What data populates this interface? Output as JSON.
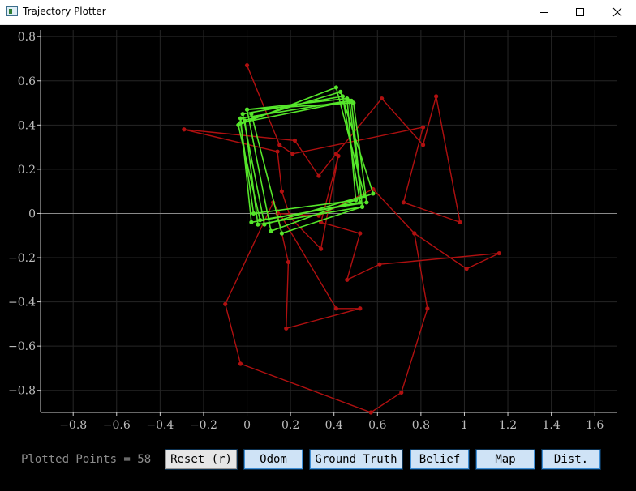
{
  "window": {
    "title": "Trajectory Plotter",
    "minimize_icon": "minimize-icon",
    "maximize_icon": "maximize-icon",
    "close_icon": "close-icon"
  },
  "status": {
    "plotted_points_label": "Plotted Points = 58"
  },
  "buttons": [
    {
      "name": "reset-button",
      "label": "Reset (r)"
    },
    {
      "name": "odom-button",
      "label": "Odom"
    },
    {
      "name": "ground-truth-button",
      "label": "Ground Truth"
    },
    {
      "name": "belief-button",
      "label": "Belief"
    },
    {
      "name": "map-button",
      "label": "Map"
    },
    {
      "name": "dist-button",
      "label": "Dist."
    }
  ],
  "colors": {
    "background": "#000000",
    "grid": "#262626",
    "axis_zero": "#8a8a8a",
    "tick_label": "#bdbdbd",
    "red_series": "#b01010",
    "green_series": "#55e62a"
  },
  "chart_data": {
    "type": "line",
    "title": "",
    "xlabel": "",
    "ylabel": "",
    "xlim": [
      -0.95,
      1.7
    ],
    "ylim": [
      -0.9,
      0.83
    ],
    "xticks": [
      -0.8,
      -0.6,
      -0.4,
      -0.2,
      0,
      0.2,
      0.4,
      0.6,
      0.8,
      1,
      1.2,
      1.4,
      1.6
    ],
    "xtick_labels": [
      "−0.8",
      "−0.6",
      "−0.4",
      "−0.2",
      "0",
      "0.2",
      "0.4",
      "0.6",
      "0.8",
      "1",
      "1.2",
      "1.4",
      "1.6"
    ],
    "yticks": [
      0.8,
      0.6,
      0.4,
      0.2,
      0,
      -0.2,
      -0.4,
      -0.6,
      -0.8
    ],
    "ytick_labels": [
      "0.8",
      "0.6",
      "0.4",
      "0.2",
      "0",
      "−0.2",
      "−0.4",
      "−0.6",
      "−0.8"
    ],
    "grid": true,
    "series": [
      {
        "color": "#b01010",
        "points": [
          [
            0.0,
            0.67
          ],
          [
            0.15,
            0.31
          ],
          [
            0.21,
            0.27
          ],
          [
            0.81,
            0.39
          ],
          [
            0.72,
            0.05
          ],
          [
            0.98,
            -0.04
          ],
          [
            0.87,
            0.53
          ],
          [
            0.81,
            0.31
          ],
          [
            0.62,
            0.52
          ],
          [
            0.41,
            0.27
          ],
          [
            0.33,
            0.17
          ],
          [
            0.22,
            0.33
          ],
          [
            -0.29,
            0.38
          ],
          [
            0.14,
            0.28
          ],
          [
            0.16,
            0.1
          ],
          [
            0.2,
            -0.02
          ],
          [
            0.34,
            -0.16
          ],
          [
            0.42,
            0.26
          ],
          [
            0.34,
            -0.04
          ],
          [
            0.52,
            -0.09
          ],
          [
            0.46,
            -0.3
          ],
          [
            0.61,
            -0.23
          ],
          [
            1.16,
            -0.18
          ],
          [
            1.01,
            -0.25
          ],
          [
            0.77,
            -0.09
          ],
          [
            0.58,
            0.11
          ],
          [
            0.33,
            -0.01
          ],
          [
            0.14,
            0.0
          ],
          [
            0.19,
            -0.22
          ],
          [
            0.18,
            -0.52
          ],
          [
            0.52,
            -0.43
          ],
          [
            0.41,
            -0.43
          ],
          [
            0.12,
            0.05
          ],
          [
            -0.1,
            -0.41
          ],
          [
            -0.03,
            -0.68
          ],
          [
            0.57,
            -0.9
          ],
          [
            0.71,
            -0.81
          ],
          [
            0.83,
            -0.43
          ],
          [
            0.77,
            -0.09
          ]
        ]
      },
      {
        "color": "#55e62a",
        "points": [
          [
            0.0,
            0.47
          ],
          [
            0.49,
            0.5
          ],
          [
            0.55,
            0.05
          ],
          [
            0.06,
            -0.03
          ],
          [
            -0.04,
            0.4
          ],
          [
            0.41,
            0.57
          ],
          [
            0.54,
            0.08
          ],
          [
            0.08,
            -0.05
          ],
          [
            -0.02,
            0.45
          ],
          [
            0.44,
            0.53
          ],
          [
            0.52,
            0.05
          ],
          [
            0.02,
            -0.04
          ],
          [
            -0.03,
            0.43
          ],
          [
            0.47,
            0.51
          ],
          [
            0.53,
            0.03
          ],
          [
            0.05,
            -0.05
          ],
          [
            -0.01,
            0.42
          ],
          [
            0.43,
            0.55
          ],
          [
            0.58,
            0.09
          ],
          [
            0.11,
            -0.08
          ],
          [
            0.0,
            0.47
          ],
          [
            0.46,
            0.52
          ],
          [
            0.5,
            0.06
          ],
          [
            0.03,
            0.0
          ],
          [
            -0.03,
            0.41
          ],
          [
            0.48,
            0.51
          ],
          [
            0.53,
            0.03
          ],
          [
            0.16,
            -0.09
          ],
          [
            0.02,
            0.45
          ]
        ]
      }
    ]
  }
}
